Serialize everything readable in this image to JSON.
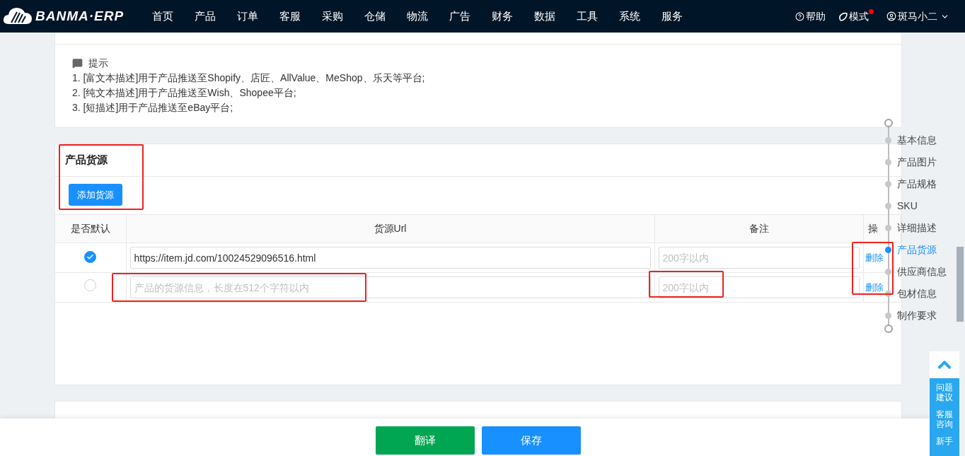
{
  "header": {
    "logo": "BANMA·ERP",
    "menu": [
      {
        "label": "首页"
      },
      {
        "label": "产品"
      },
      {
        "label": "订单"
      },
      {
        "label": "客服"
      },
      {
        "label": "采购"
      },
      {
        "label": "仓储"
      },
      {
        "label": "物流"
      },
      {
        "label": "广告"
      },
      {
        "label": "财务"
      },
      {
        "label": "数据"
      },
      {
        "label": "工具"
      },
      {
        "label": "系统"
      },
      {
        "label": "服务"
      }
    ],
    "help": "帮助",
    "mode": {
      "label": "模式",
      "notification": true
    },
    "user": "斑马小二"
  },
  "tips": {
    "title": "提示",
    "lines": [
      "1. [富文本描述]用于产品推送至Shopify、店匠、AllValue、MeShop、乐天等平台;",
      "2. [纯文本描述]用于产品推送至Wish、Shopee平台;",
      "3. [短描述]用于产品推送至eBay平台;"
    ]
  },
  "source_card": {
    "title": "产品货源",
    "add_button": "添加货源",
    "columns": [
      "是否默认",
      "货源Url",
      "备注",
      "操"
    ],
    "rows": [
      {
        "selected": true,
        "url": {
          "value": "https://item.jd.com/10024529096516.html"
        },
        "remark": {
          "placeholder": "200字以内"
        },
        "action": "删除"
      },
      {
        "selected": false,
        "url": {
          "placeholder": "产品的货源信息，长度在512个字符以内"
        },
        "remark": {
          "placeholder": "200字以内"
        },
        "action": "删除"
      }
    ]
  },
  "anchor_nav": [
    {
      "label": "基本信息",
      "selected": false
    },
    {
      "label": "产品图片",
      "selected": false
    },
    {
      "label": "产品规格",
      "selected": false
    },
    {
      "label": "SKU",
      "selected": false
    },
    {
      "label": "详细描述",
      "selected": false
    },
    {
      "label": "产品货源",
      "selected": true
    },
    {
      "label": "供应商信息",
      "selected": false
    },
    {
      "label": "包材信息",
      "selected": false
    },
    {
      "label": "制作要求",
      "selected": false
    }
  ],
  "feedback_widget": [
    "问题建议",
    "客服咨询",
    "新手"
  ],
  "footer": {
    "buttons": [
      {
        "label": "翻译",
        "color": "#00a651"
      },
      {
        "label": "保存",
        "color": "#1890ff"
      }
    ]
  }
}
